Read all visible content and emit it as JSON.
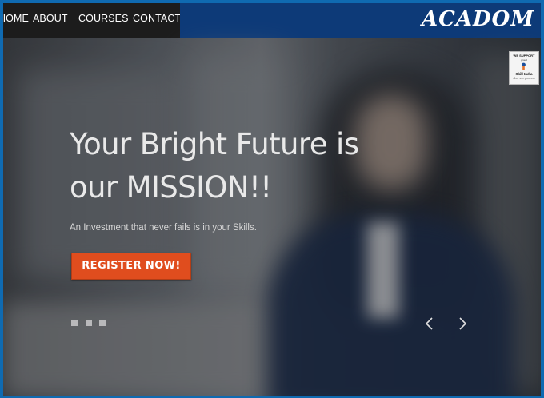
{
  "nav": {
    "items": [
      {
        "label": "HOME"
      },
      {
        "label": "ABOUT"
      },
      {
        "label": "COURSES"
      },
      {
        "label": "CONTACT"
      }
    ]
  },
  "brand": {
    "logo": "ACADOM"
  },
  "hero": {
    "title_line1": "Your Bright Future is",
    "title_line2": "our MISSION!!",
    "tagline": "An Investment that never fails is in your Skills.",
    "cta_label": "REGISTER NOW!",
    "slides_count": 3,
    "prev_icon": "chevron-left-icon",
    "next_icon": "chevron-right-icon"
  },
  "badge": {
    "line1": "WE SUPPORT",
    "line2": "proud",
    "line3": "Skill India",
    "line4": "कौशल भारत कुशल भारत"
  },
  "colors": {
    "frame": "#0f6ab1",
    "header_blue": "#0d3a78",
    "nav_bg": "#1c1c1c",
    "cta_orange": "#e04d1e"
  }
}
